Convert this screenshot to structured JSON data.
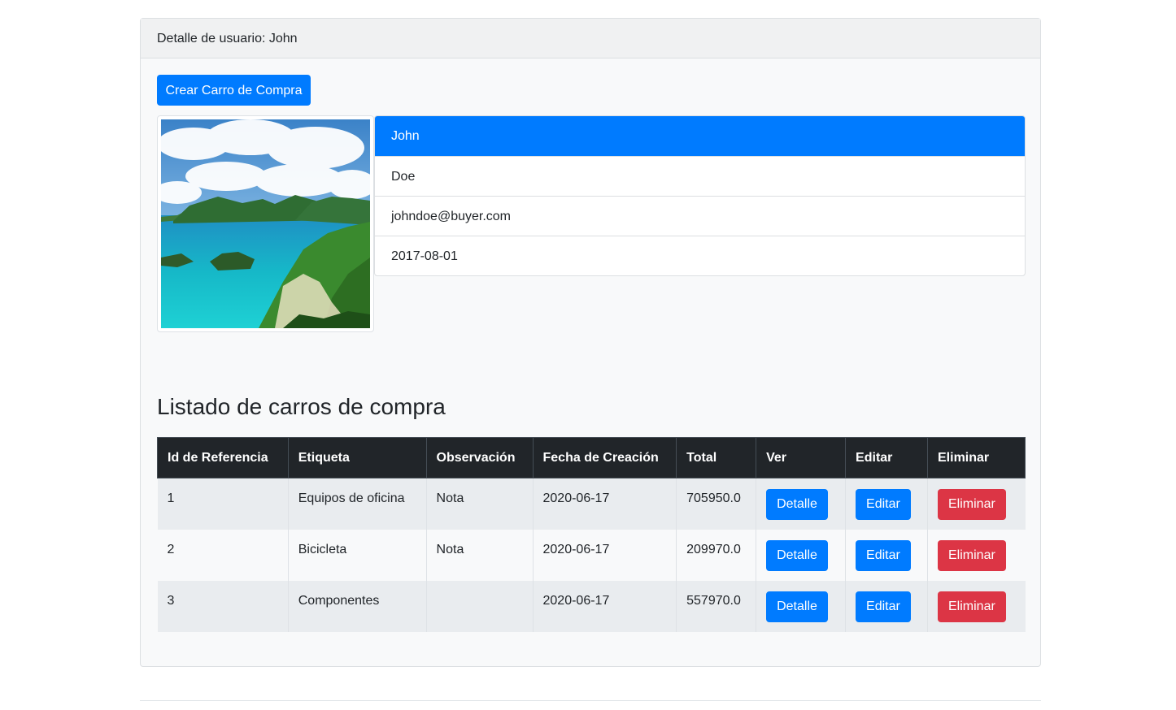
{
  "card": {
    "header": "Detalle de usuario: John",
    "create_button": "Crear Carro de Compra"
  },
  "user": {
    "first_name": "John",
    "last_name": "Doe",
    "email": "johndoe@buyer.com",
    "date": "2017-08-01"
  },
  "carts": {
    "title": "Listado de carros de compra",
    "columns": [
      "Id de Referencia",
      "Etiqueta",
      "Observación",
      "Fecha de Creación",
      "Total",
      "Ver",
      "Editar",
      "Eliminar"
    ],
    "rows": [
      {
        "id": "1",
        "label": "Equipos de oficina",
        "note": "Nota",
        "created": "2020-06-17",
        "total": "705950.0",
        "view": "Detalle",
        "edit": "Editar",
        "delete": "Eliminar"
      },
      {
        "id": "2",
        "label": "Bicicleta",
        "note": "Nota",
        "created": "2020-06-17",
        "total": "209970.0",
        "view": "Detalle",
        "edit": "Editar",
        "delete": "Eliminar"
      },
      {
        "id": "3",
        "label": "Componentes",
        "note": "",
        "created": "2020-06-17",
        "total": "557970.0",
        "view": "Detalle",
        "edit": "Editar",
        "delete": "Eliminar"
      }
    ]
  },
  "colors": {
    "primary": "#007bff",
    "danger": "#dc3545",
    "table_header": "#212529"
  }
}
